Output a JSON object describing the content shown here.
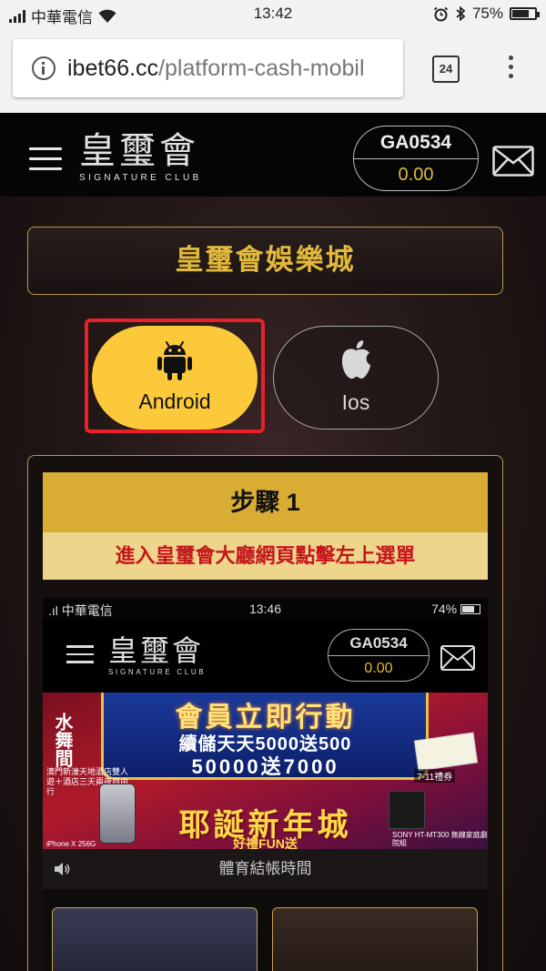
{
  "status_bar": {
    "carrier": "中華電信",
    "time": "13:42",
    "battery": "75%",
    "battery_level": 0.75
  },
  "browser": {
    "url_domain": "ibet66.cc",
    "url_path": "/platform-cash-mobil",
    "tab_count": "24"
  },
  "header": {
    "logo_cn": "皇璽會",
    "logo_en": "SIGNATURE CLUB",
    "account_id": "GA0534",
    "balance": "0.00"
  },
  "page": {
    "title": "皇璽會娛樂城"
  },
  "os_tabs": [
    {
      "label": "Android",
      "selected": true
    },
    {
      "label": "Ios",
      "selected": false
    }
  ],
  "guide": {
    "step_title": "步驟 1",
    "step_desc": "進入皇璽會大廳網頁點擊左上選單"
  },
  "screenshot": {
    "status": {
      "carrier": "中華電信",
      "time": "13:46",
      "battery": "74%"
    },
    "header": {
      "logo_cn": "皇璽會",
      "logo_en": "SIGNATURE CLUB",
      "account_id": "GA0534",
      "balance": "0.00"
    },
    "promo": {
      "line1": "會員立即行動",
      "line2": "續儲天天5000送500",
      "line3": "50000送7000",
      "line4": "耶誕新年城",
      "line5": "好禮FUN送",
      "vertical_text": "水舞間",
      "hotel_caption": "澳門新濠天地酒店雙人遊＋酒店三天兩夜自由行",
      "coupon_caption": "7-11禮券",
      "sony_caption": "SONY HT-MT300 無線家庭劇院組",
      "iphone_caption": "iPhone X 256G"
    },
    "notice": "體育結帳時間"
  },
  "colors": {
    "gold": "#e2b93b",
    "android_yellow": "#fcc93a",
    "step_header": "#d9ad33",
    "step_desc_bg": "#eed58c",
    "step_desc_text": "#c4161c",
    "highlight": "#e8202a"
  }
}
